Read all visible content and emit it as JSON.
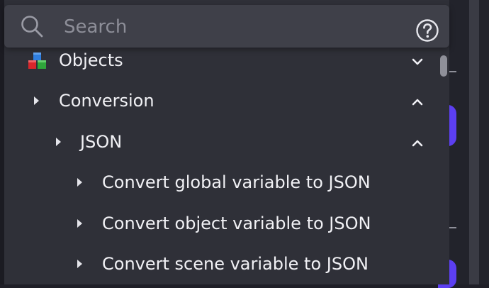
{
  "search": {
    "placeholder": "Search",
    "value": "",
    "search_icon": "search-icon",
    "help_icon": "help-circle-icon"
  },
  "tree": {
    "objects": {
      "label": "Objects",
      "icon": "objects-cubes-icon",
      "chevron": "chevron-down-icon"
    },
    "conversion": {
      "label": "Conversion",
      "chevron": "chevron-up-icon"
    },
    "json": {
      "label": "JSON",
      "chevron": "chevron-up-icon"
    },
    "items": [
      {
        "label": "Convert global variable to JSON"
      },
      {
        "label": "Convert object variable to JSON"
      },
      {
        "label": "Convert scene variable to JSON"
      }
    ]
  },
  "colors": {
    "panel": "#2f3038",
    "search_bar": "#3f4049",
    "text": "#f1f1f5",
    "accent": "#5c3ff1"
  }
}
